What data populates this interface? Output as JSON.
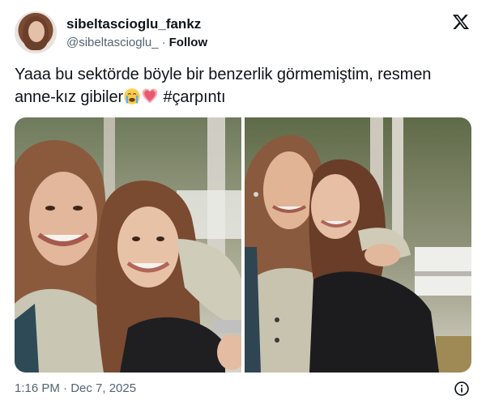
{
  "user": {
    "display_name": "sibeltascioglu_fankz",
    "handle": "@sibeltascioglu_",
    "separator": "·",
    "follow_label": "Follow"
  },
  "tweet": {
    "text_line1": "Yaaa bu sektörde böyle bir benzerlik görmemiştim, resmen",
    "text_line2_prefix": "anne-kız gibiler",
    "emojis": [
      "loudly-crying-face",
      "sparkling-heart"
    ],
    "hashtag": "#çarpıntı"
  },
  "media": {
    "count": 2,
    "photos": [
      "two-women-smiling-closeup",
      "two-women-hugging-outdoors"
    ]
  },
  "footer": {
    "timestamp": "1:16 PM · Dec 7, 2025"
  },
  "icons": {
    "brand": "x-logo-icon",
    "info": "info-icon"
  },
  "colors": {
    "text": "#0f1419",
    "secondary": "#536471",
    "background": "#ffffff"
  }
}
